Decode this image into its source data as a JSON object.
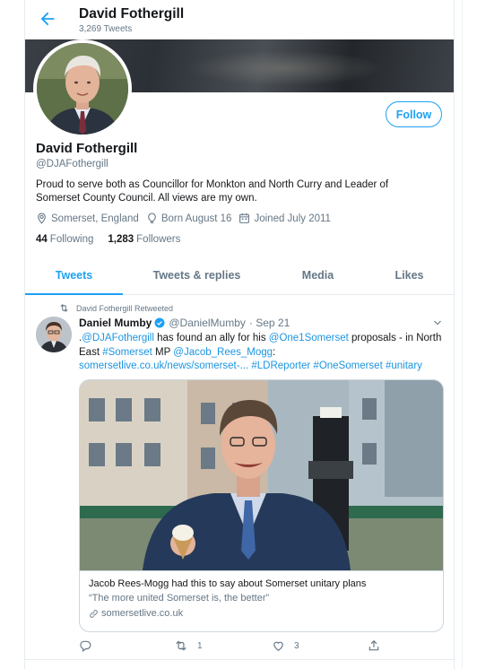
{
  "header": {
    "name": "David Fothergill",
    "tweet_count": "3,269 Tweets"
  },
  "profile": {
    "name": "David Fothergill",
    "handle": "@DJAFothergill",
    "follow_label": "Follow",
    "bio": "Proud to serve both as Councillor for Monkton and North Curry and Leader of Somerset County Council. All views are my own.",
    "location": "Somerset, England",
    "born": "Born August 16",
    "joined": "Joined July 2011",
    "following_count": "44",
    "following_label": "Following",
    "followers_count": "1,283",
    "followers_label": "Followers"
  },
  "tabs": [
    {
      "label": "Tweets",
      "active": true
    },
    {
      "label": "Tweets & replies",
      "active": false
    },
    {
      "label": "Media",
      "active": false
    },
    {
      "label": "Likes",
      "active": false
    }
  ],
  "tweet": {
    "retweet_note": "David Fothergill Retweeted",
    "author_name": "Daniel Mumby",
    "author_handle": "@DanielMumby",
    "date": "· Sep 21",
    "text": {
      "p1": ".",
      "m1": "@DJAFothergill",
      "p2": " has found an ally for his ",
      "m2": "@One1Somerset",
      "p3": " proposals - in North East ",
      "h1": "#Somerset",
      "p4": " MP ",
      "m3": "@Jacob_Rees_Mogg",
      "p5": ":",
      "url": "somersetlive.co.uk/news/somerset-...",
      "h2": "#LDReporter",
      "h3": "#OneSomerset",
      "h4": "#unitary"
    },
    "card": {
      "title": "Jacob Rees-Mogg had this to say about Somerset unitary plans",
      "description": "“The more united Somerset is, the better”",
      "domain": "somersetlive.co.uk"
    },
    "actions": {
      "reply_count": "",
      "retweet_count": "1",
      "like_count": "3"
    }
  },
  "colors": {
    "accent": "#1da1f2",
    "link": "#1b95e0",
    "secondary_text": "#657786",
    "border": "#e6ecf0"
  },
  "icons": [
    "back-arrow-icon",
    "location-icon",
    "balloon-icon",
    "calendar-icon",
    "retweet-icon",
    "verified-icon",
    "chevron-down-icon",
    "link-icon",
    "reply-icon",
    "like-icon",
    "share-icon"
  ]
}
